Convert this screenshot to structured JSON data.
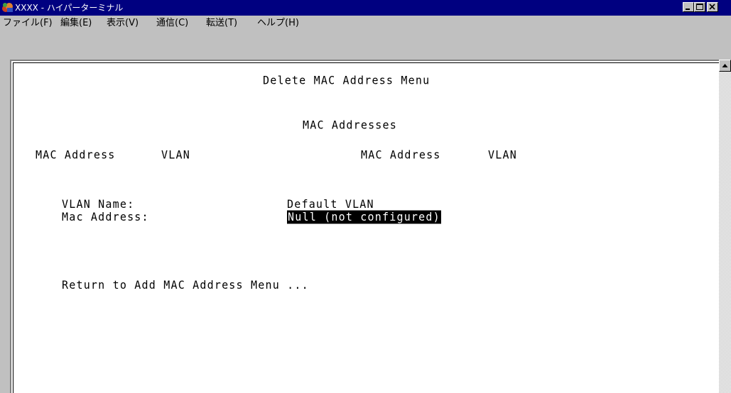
{
  "window": {
    "title": "XXXX - ハイパーターミナル",
    "minimize_icon": "minimize-icon",
    "maximize_icon": "maximize-icon",
    "close_icon": "close-icon"
  },
  "menubar": {
    "items": [
      {
        "label": "ファイル(F)"
      },
      {
        "label": "編集(E)"
      },
      {
        "label": "表示(V)"
      },
      {
        "label": "通信(C)"
      },
      {
        "label": "転送(T)"
      },
      {
        "label": "ヘルプ(H)"
      }
    ]
  },
  "terminal": {
    "menu_title": "Delete MAC Address Menu",
    "section_heading": "MAC Addresses",
    "col_mac_left": "MAC Address",
    "col_vlan_left": "VLAN",
    "col_mac_right": "MAC Address",
    "col_vlan_right": "VLAN",
    "vlan_name_label": "VLAN Name:",
    "vlan_name_value": "Default VLAN",
    "mac_address_label": "Mac Address:",
    "mac_address_value": "Null (not configured)",
    "return_link": "Return to Add MAC Address Menu ..."
  },
  "colors": {
    "title_bar": "#000080",
    "window_chrome": "#c0c0c0",
    "terminal_bg": "#ffffff",
    "terminal_text": "#000000"
  }
}
